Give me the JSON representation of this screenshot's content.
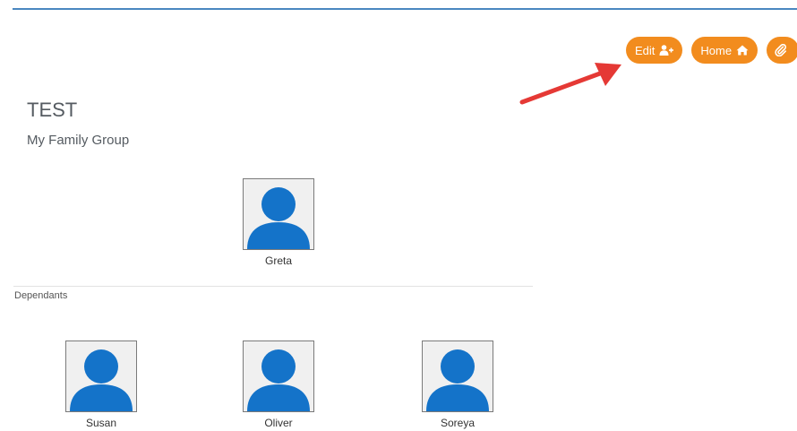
{
  "toolbar": {
    "edit_label": "Edit",
    "home_label": "Home"
  },
  "group": {
    "title": "TEST",
    "subtitle": "My Family Group"
  },
  "head_member": {
    "name": "Greta"
  },
  "dependants": {
    "label": "Dependants",
    "members": [
      {
        "name": "Susan"
      },
      {
        "name": "Oliver"
      },
      {
        "name": "Soreya"
      }
    ]
  },
  "colors": {
    "accent": "#f28c1e",
    "avatar_blue": "#1473c9",
    "top_rule": "#4a87c0",
    "arrow": "#e53935"
  },
  "icons": {
    "edit": "user-plus-icon",
    "home": "home-icon",
    "tools": "paperclip-icon",
    "avatar": "person-silhouette-icon"
  }
}
